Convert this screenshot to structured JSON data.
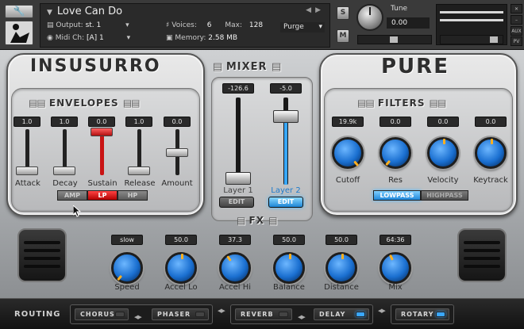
{
  "header": {
    "instrument_name": "Love Can Do",
    "output_label": "Output:",
    "output_value": "st. 1",
    "midi_label": "Midi Ch:",
    "midi_value": "[A]  1",
    "voices_label": "Voices:",
    "voices_value": "6",
    "max_label": "Max:",
    "max_value": "128",
    "memory_label": "Memory:",
    "memory_value": "2.58 MB",
    "purge_label": "Purge",
    "solo_label": "S",
    "mute_label": "M",
    "tune_label": "Tune",
    "tune_value": "0.00",
    "side_labels": [
      "AUX",
      "PV"
    ]
  },
  "left_panel": {
    "title": "INSUSURRO",
    "envelopes_title": "ENVELOPES",
    "sliders": [
      {
        "label": "Attack",
        "value": "1.0"
      },
      {
        "label": "Decay",
        "value": "1.0"
      },
      {
        "label": "Sustain",
        "value": "0.0"
      },
      {
        "label": "Release",
        "value": "1.0"
      },
      {
        "label": "Amount",
        "value": "0.0"
      }
    ],
    "modes": [
      {
        "label": "AMP",
        "active": false
      },
      {
        "label": "LP",
        "active": true
      },
      {
        "label": "HP",
        "active": false
      }
    ]
  },
  "mixer": {
    "title": "MIXER",
    "channels": [
      {
        "label": "Layer 1",
        "value": "-126.6",
        "edit_label": "EDIT",
        "edit_active": false
      },
      {
        "label": "Layer 2",
        "value": "-5.0",
        "edit_label": "EDIT",
        "edit_active": true
      }
    ],
    "fx_title": "FX"
  },
  "right_panel": {
    "title": "PURE",
    "filters_title": "FILTERS",
    "knobs": [
      {
        "label": "Cutoff",
        "value": "19.9k"
      },
      {
        "label": "Res",
        "value": "0.0"
      },
      {
        "label": "Velocity",
        "value": "0.0"
      },
      {
        "label": "Keytrack",
        "value": "0.0"
      }
    ],
    "modes": [
      {
        "label": "LOWPASS",
        "active": true
      },
      {
        "label": "HIGHPASS",
        "active": false
      }
    ]
  },
  "fx": {
    "knobs": [
      {
        "label": "Speed",
        "value": "slow"
      },
      {
        "label": "Accel Lo",
        "value": "50.0"
      },
      {
        "label": "Accel Hi",
        "value": "37.3"
      },
      {
        "label": "Balance",
        "value": "50.0"
      },
      {
        "label": "Distance",
        "value": "50.0"
      },
      {
        "label": "Mix",
        "value": "64:36"
      }
    ]
  },
  "routing": {
    "label": "ROUTING",
    "groups": [
      [
        {
          "label": "CHORUS",
          "on": false
        },
        {
          "label": "PHASER",
          "on": false
        }
      ],
      [
        {
          "label": "REVERB",
          "on": false
        },
        {
          "label": "DELAY",
          "on": true
        }
      ],
      [
        {
          "label": "ROTARY",
          "on": true
        }
      ]
    ]
  },
  "colors": {
    "accent_blue": "#1a6fd0",
    "knob_pointer": "#ffb020",
    "active_red": "#d01515",
    "led_blue": "#3aa7ff"
  }
}
